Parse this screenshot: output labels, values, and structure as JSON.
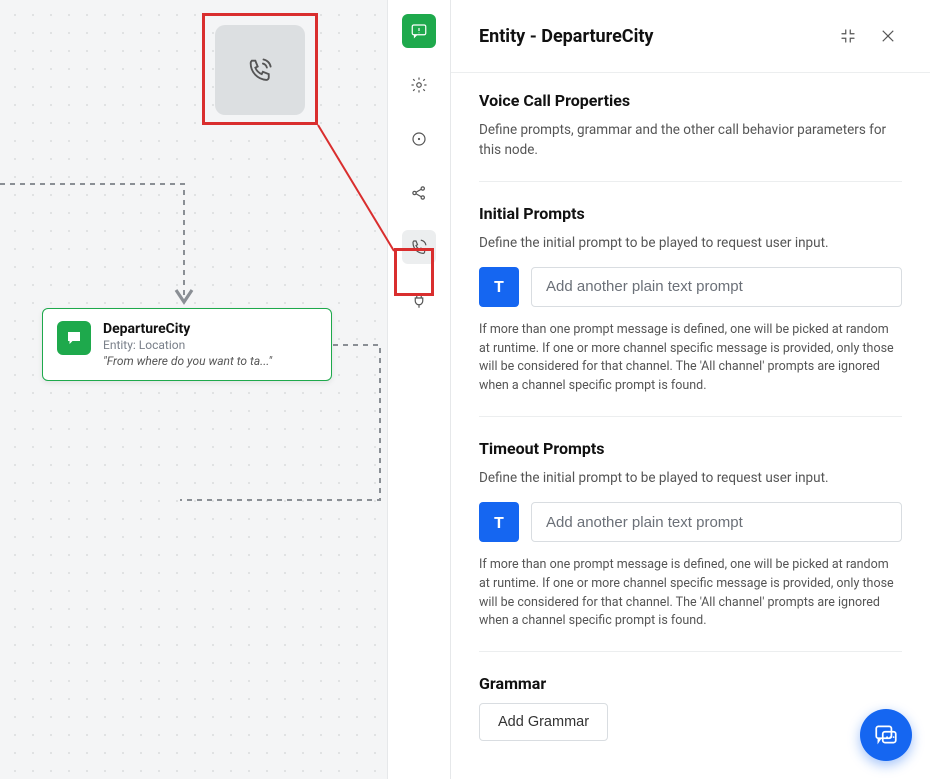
{
  "canvas": {
    "phone_tile_icon": "phone-outgoing",
    "node": {
      "title": "DepartureCity",
      "subtitle": "Entity: Location",
      "quote": "\"From where do you want to ta...\""
    }
  },
  "rail": {
    "items": [
      {
        "name": "prompts",
        "icon": "chat-badge",
        "primary": true
      },
      {
        "name": "settings",
        "icon": "gear"
      },
      {
        "name": "instance",
        "icon": "target"
      },
      {
        "name": "connections",
        "icon": "share"
      },
      {
        "name": "voice-call",
        "icon": "phone",
        "selected": true
      },
      {
        "name": "ivr",
        "icon": "plug"
      }
    ]
  },
  "panel": {
    "title": "Entity - DepartureCity",
    "voice_props": {
      "heading": "Voice Call Properties",
      "desc": "Define prompts, grammar and the other call behavior parameters for this node."
    },
    "initial_prompts": {
      "heading": "Initial Prompts",
      "desc": "Define the initial prompt to be played to request user input.",
      "type_badge": "T",
      "placeholder": "Add another plain text prompt",
      "note": "If more than one prompt message is defined, one will be picked at random at runtime. If one or more channel specific message is provided, only those will be considered for that channel. The 'All channel' prompts are ignored when a channel specific prompt is found."
    },
    "timeout_prompts": {
      "heading": "Timeout Prompts",
      "desc": "Define the initial prompt to be played to request user input.",
      "type_badge": "T",
      "placeholder": "Add another plain text prompt",
      "note": "If more than one prompt message is defined, one will be picked at random at runtime. If one or more channel specific message is provided, only those will be considered for that channel. The 'All channel' prompts are ignored when a channel specific prompt is found."
    },
    "grammar": {
      "heading": "Grammar",
      "button": "Add Grammar"
    }
  }
}
